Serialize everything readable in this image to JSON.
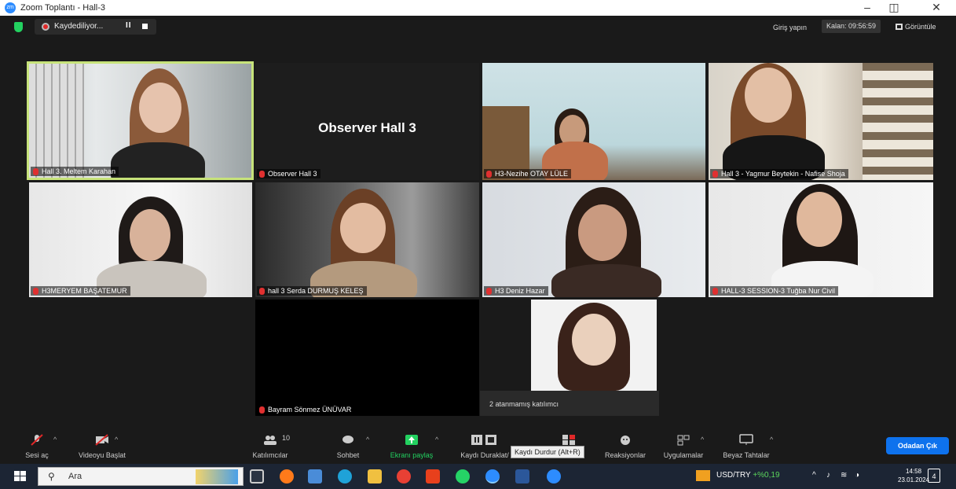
{
  "window": {
    "title": "Zoom Toplantı - Hall-3"
  },
  "topbar": {
    "recording_label": "Kaydediliyor...",
    "signin": "Giriş yapın",
    "remaining": "Kalan: 09:56:59",
    "view": "Görüntüle"
  },
  "tiles": [
    {
      "name": "Hall 3. Meltem Karahan"
    },
    {
      "name": "Observer Hall 3",
      "display": "Observer Hall 3"
    },
    {
      "name": "H3-Nezihe OTAY LÜLE"
    },
    {
      "name": "Hall 3 - Yagmur Beytekin - Nafise Shoja"
    },
    {
      "name": "H3MERYEM BAŞATEMUR"
    },
    {
      "name": "hall 3 Serda DURMUŞ KELEŞ"
    },
    {
      "name": "H3 Deniz Hazar"
    },
    {
      "name": "HALL-3 SESSION-3 Tuğba Nur Civil"
    },
    {
      "name": "Bayram Sönmez ÜNÜVAR"
    }
  ],
  "assigned": "2 atanmamış katılımcı",
  "toolbar": {
    "audio": "Sesi aç",
    "video": "Videoyu Başlat",
    "participants": "Katılımcılar",
    "participants_count": "10",
    "chat": "Sohbet",
    "share": "Ekranı paylaş",
    "record": "Kaydı Duraklat/",
    "reactions": "Reaksiyonlar",
    "apps": "Uygulamalar",
    "whiteboard": "Beyaz Tahtalar",
    "leave": "Odadan Çık",
    "tooltip": "Kaydı Durdur (Alt+R)"
  },
  "taskbar": {
    "search": "Ara",
    "ticker_name": "USD/TRY",
    "ticker_value": "+%0,19",
    "time": "14:58",
    "date": "23.01.2024",
    "notif": "4"
  },
  "colors": {
    "accent": "#0e72ed",
    "recording": "#e02828",
    "active_speaker_border": "#c7e37a"
  }
}
